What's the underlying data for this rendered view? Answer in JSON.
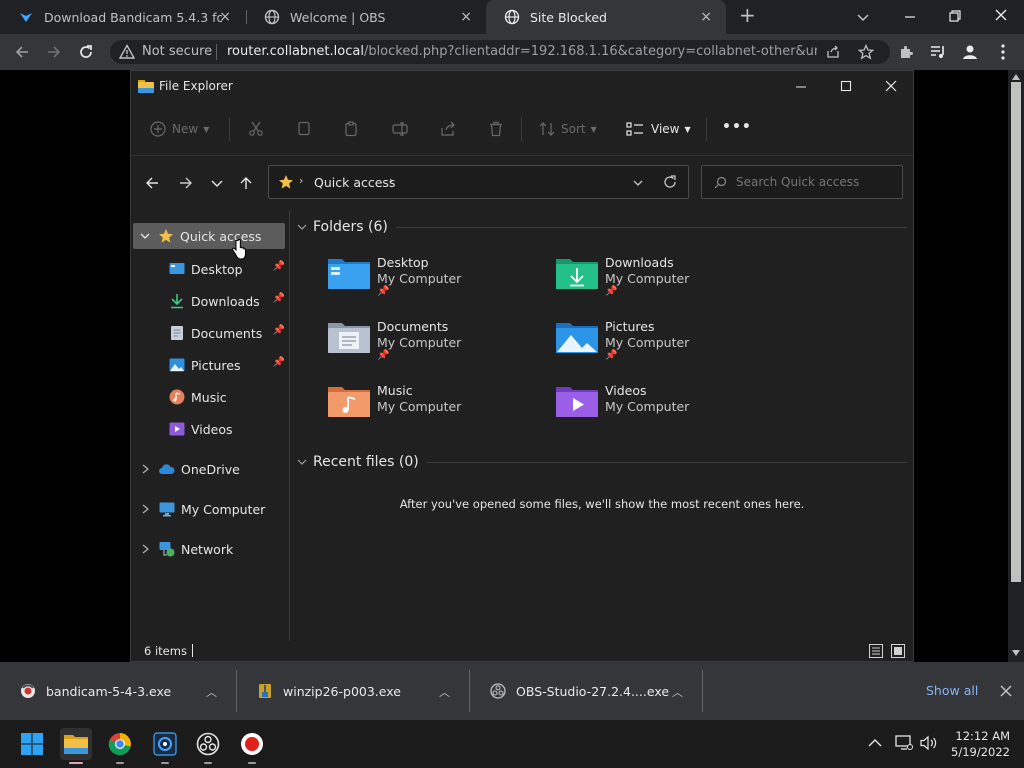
{
  "browser": {
    "tabs": [
      {
        "label": "Download Bandicam 5.4.3 for Wi",
        "close": "×"
      },
      {
        "label": "Welcome | OBS",
        "close": "×"
      },
      {
        "label": "Site Blocked",
        "close": "×",
        "active": true
      }
    ],
    "new_tab": "+",
    "security_label": "Not secure",
    "url_host": "router.collabnet.local",
    "url_path": "/blocked.php?clientaddr=192.168.1.16&category=collabnet-other&url=..."
  },
  "explorer": {
    "title": "File Explorer",
    "toolbar": {
      "new": "New",
      "sort": "Sort",
      "view": "View",
      "more": "•••"
    },
    "address": {
      "location": "Quick access"
    },
    "search": {
      "placeholder": "Search Quick access"
    },
    "nav": {
      "quick_access": "Quick access",
      "pinned": [
        {
          "label": "Desktop",
          "icon": "desktop-icon",
          "pinned": true
        },
        {
          "label": "Downloads",
          "icon": "downloads-icon",
          "pinned": true
        },
        {
          "label": "Documents",
          "icon": "documents-icon",
          "pinned": true
        },
        {
          "label": "Pictures",
          "icon": "pictures-icon",
          "pinned": true
        },
        {
          "label": "Music",
          "icon": "music-icon",
          "pinned": false
        },
        {
          "label": "Videos",
          "icon": "videos-icon",
          "pinned": false
        }
      ],
      "roots": [
        "OneDrive",
        "My Computer",
        "Network"
      ]
    },
    "folders_heading": "Folders (6)",
    "folders": [
      {
        "name": "Desktop",
        "location": "My Computer",
        "pinned": true
      },
      {
        "name": "Downloads",
        "location": "My Computer",
        "pinned": true
      },
      {
        "name": "Documents",
        "location": "My Computer",
        "pinned": true
      },
      {
        "name": "Pictures",
        "location": "My Computer",
        "pinned": true
      },
      {
        "name": "Music",
        "location": "My Computer",
        "pinned": false
      },
      {
        "name": "Videos",
        "location": "My Computer",
        "pinned": false
      }
    ],
    "recent_heading": "Recent files (0)",
    "recent_empty": "After you've opened some files, we'll show the most recent ones here.",
    "status": "6 items"
  },
  "downloads": {
    "items": [
      "bandicam-5-4-3.exe",
      "winzip26-p003.exe",
      "OBS-Studio-27.2.4....exe"
    ],
    "show_all": "Show all"
  },
  "taskbar": {
    "time": "12:12 AM",
    "date": "5/19/2022"
  },
  "colors": {
    "accent": "#0078d4",
    "folder_yellow": "#f2c049",
    "chrome_bg": "#202124"
  }
}
